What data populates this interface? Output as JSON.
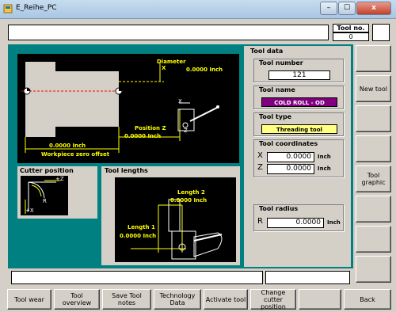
{
  "window": {
    "title": "E_Reihe_PC",
    "controls": [
      "–",
      "☐",
      "x"
    ]
  },
  "tool_no": {
    "label": "Tool no.",
    "value": "0"
  },
  "drawing": {
    "diameter_label": "Diameter",
    "diameter_symbol": "X",
    "diameter_value": "0.0000 Inch",
    "positionz_label": "Position Z",
    "positionz_value": "0.0000 Inch",
    "zero_offset_value": "0.0000 Inch",
    "zero_offset_label": "Workpiece zero offset",
    "cutter_x": "X",
    "cutter_z": "Z"
  },
  "cutter_position": {
    "title": "Cutter position",
    "z": "+Z",
    "r": "R",
    "x": "+X"
  },
  "tool_lengths": {
    "title": "Tool lengths",
    "length2_label": "Length 2",
    "length2_value": "0.0000 Inch",
    "length1_label": "Length 1",
    "length1_value": "0.0000 Inch"
  },
  "tool_data": {
    "title": "Tool data",
    "tool_number_label": "Tool number",
    "tool_number_value": "121",
    "tool_name_label": "Tool name",
    "tool_name_value": "COLD ROLL - OD",
    "tool_name_color": "#800080",
    "tool_type_label": "Tool type",
    "tool_type_value": "Threading tool",
    "tool_type_color": "#ffff80",
    "coords_label": "Tool coordinates",
    "x_label": "X",
    "x_value": "0.0000",
    "z_label": "Z",
    "z_value": "0.0000",
    "unit": "Inch",
    "radius_label": "Tool radius",
    "r_label": "R",
    "r_value": "0.0000"
  },
  "side_buttons": [
    "",
    "New tool",
    "",
    "",
    "Tool graphic",
    "",
    "",
    ""
  ],
  "bottom_buttons": [
    "Tool wear",
    "Tool overview",
    "Save Tool notes",
    "Technology Data",
    "Activate tool",
    "Change cutter position",
    "",
    "Back"
  ],
  "colors": {
    "teal": "#008080",
    "yellow": "#ffff00"
  }
}
